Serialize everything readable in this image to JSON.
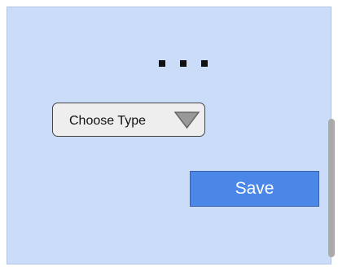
{
  "form": {
    "header_icon": "ellipsis-icon",
    "type_select": {
      "selected_label": "Choose Type",
      "arrow_icon": "triangle-down-icon"
    },
    "save_label": "Save"
  },
  "colors": {
    "panel_background": "#cadcf7",
    "save_button": "#4a87e6",
    "select_background": "#eeeeee",
    "select_arrow": "#999999",
    "scrollbar": "#aaaaaa"
  },
  "scroll": {
    "visible": true
  }
}
